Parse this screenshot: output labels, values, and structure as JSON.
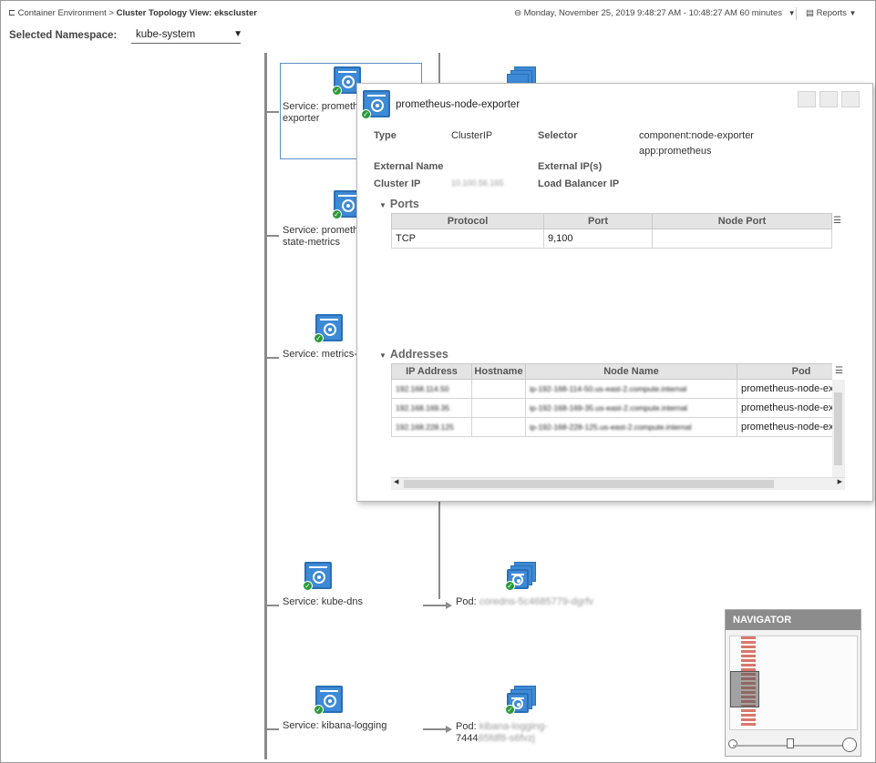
{
  "header": {
    "breadcrumb_parent": "Container Environment",
    "breadcrumb_sep": ">",
    "page_title": "Cluster Topology View: ekscluster",
    "time_range": "Monday, November 25, 2019 9:48:27 AM - 10:48:27 AM 60 minutes",
    "reports_label": "Reports"
  },
  "namespace": {
    "label": "Selected Namespace:",
    "value": "kube-system"
  },
  "topology": {
    "services": [
      {
        "line1": "Service: prometh",
        "line2": "exporter"
      },
      {
        "line1": "Service: prometh",
        "line2": "state-metrics"
      },
      {
        "line1": "Service: metrics-s",
        "line2": ""
      },
      {
        "line1": "Service: kube-dns",
        "line2": ""
      },
      {
        "line1": "Service: kibana-logging",
        "line2": ""
      }
    ],
    "pods": [
      {
        "label": "Pod:",
        "name": "coredns-5c4685779-dgrfv",
        "name2": ""
      },
      {
        "label": "Pod:",
        "name": "kibana-logging-",
        "name2": "7444",
        "name3": "65fdf8-s6fvzj"
      }
    ]
  },
  "popup": {
    "title": "prometheus-node-exporter",
    "fields": {
      "type_label": "Type",
      "type_value": "ClusterIP",
      "selector_label": "Selector",
      "selector_value1": "component:node-exporter",
      "selector_value2": "app:prometheus",
      "external_name_label": "External Name",
      "external_ip_label": "External IP(s)",
      "cluster_ip_label": "Cluster IP",
      "cluster_ip_value": "10.100.56.165",
      "lb_ip_label": "Load Balancer IP"
    },
    "ports": {
      "section_label": "Ports",
      "columns": [
        "Protocol",
        "Port",
        "Node Port"
      ],
      "rows": [
        [
          "TCP",
          "9,100",
          ""
        ]
      ]
    },
    "addresses": {
      "section_label": "Addresses",
      "columns": [
        "IP Address",
        "Hostname",
        "Node Name",
        "Pod"
      ],
      "rows": [
        [
          "192.168.114.50",
          "",
          "ip-192-168-114-50.us-east-2.compute.internal",
          "prometheus-node-exp"
        ],
        [
          "192.168.169.35",
          "",
          "ip-192-168-169-35.us-east-2.compute.internal",
          "prometheus-node-exp"
        ],
        [
          "192.168.228.125",
          "",
          "ip-192-168-228-125.us-east-2.compute.internal",
          "prometheus-node-exp"
        ]
      ]
    }
  },
  "navigator": {
    "title": "NAVIGATOR"
  },
  "colors": {
    "k8s_blue": "#3d8ad6",
    "ok_green": "#2a9a3a",
    "nav_header": "#8c8c8c"
  }
}
